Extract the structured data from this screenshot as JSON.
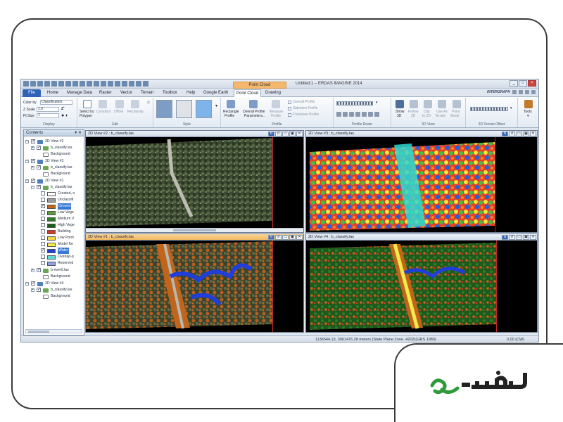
{
  "window": {
    "title": "Untitled:1 – ERDAS IMAGINE 2014",
    "context_tab": "Point Cloud",
    "brand": "INTERGRAPH"
  },
  "tabs": [
    {
      "label": "File"
    },
    {
      "label": "Home"
    },
    {
      "label": "Manage Data"
    },
    {
      "label": "Raster"
    },
    {
      "label": "Vector"
    },
    {
      "label": "Terrain"
    },
    {
      "label": "Toolbox"
    },
    {
      "label": "Help"
    },
    {
      "label": "Google Earth"
    },
    {
      "label": "Point Cloud"
    },
    {
      "label": "Drawing"
    }
  ],
  "ribbon": {
    "display": {
      "color_by_label": "Color by",
      "color_by_value": "Classification",
      "z_scale_label": "Z Scale",
      "z_scale_value": "1.0",
      "pt_size_label": "Pt Size",
      "pt_size_value": "1",
      "group": "Display"
    },
    "edit": {
      "select_by": "Select by",
      "polygon": "Polygon",
      "constant": "Constant",
      "offset": "Offset",
      "reclassify": "Reclassify",
      "group": "Edit"
    },
    "style": {
      "group": "Style"
    },
    "profile": {
      "rectangle": "Rectangle",
      "rectangle_sub": "Profile",
      "overall_params": "Overall Profile",
      "overall_params_sub": "Parameters...",
      "measure": "Measure",
      "measure_sub": "Profile",
      "overall": "Overall Profile",
      "sideview": "Sideview Profile",
      "frontview": "Frontview Profile",
      "group": "Profile"
    },
    "profile_roam": {
      "group": "Profile Roam"
    },
    "view3d": {
      "show": "Show",
      "show_sub": "3D",
      "follow": "Follow",
      "follow_sub": "2D",
      "clip": "Clip",
      "clip_sub": "to 2D",
      "use_as": "Use As",
      "use_as_sub": "Terrain",
      "point": "Point",
      "point_sub": "Mode",
      "group": "3D View"
    },
    "terrain_offset": {
      "group": "3D Terrain Offset"
    },
    "tools": {
      "label": "Tools"
    }
  },
  "contents": {
    "title": "Contents",
    "tree": [
      {
        "label": "2D View #2"
      },
      {
        "label": "b_classify.las"
      },
      {
        "label": "Background"
      },
      {
        "label": "2D View #3"
      },
      {
        "label": "b_classify.las"
      },
      {
        "label": "Background"
      },
      {
        "label": "2D View #1"
      },
      {
        "label": "b_classify.las"
      },
      {
        "label": "Created, n"
      },
      {
        "label": "Unclassifi"
      },
      {
        "label": "Ground"
      },
      {
        "label": "Low Vege"
      },
      {
        "label": "Medium V"
      },
      {
        "label": "High Vege"
      },
      {
        "label": "Building"
      },
      {
        "label": "Low Point"
      },
      {
        "label": "Model Ke"
      },
      {
        "label": "Water"
      },
      {
        "label": "Overlap-p"
      },
      {
        "label": "Reserved"
      },
      {
        "label": "b-river0.las"
      },
      {
        "label": "Background"
      },
      {
        "label": "2D View #4"
      },
      {
        "label": "b_classify.las"
      },
      {
        "label": "Background"
      }
    ]
  },
  "views": {
    "v2": {
      "title": "2D View #2 : b_classify.las"
    },
    "v3": {
      "title": "2D View #3 : b_classify.las"
    },
    "v1": {
      "title": "2D View #1 : b_classify.las"
    },
    "v4": {
      "title": "2D View #4 : b_classify.las"
    }
  },
  "statusbar": {
    "coords": "1136544.13, 3061476.28 meters (State Plane Zone -4202)(GRS 1980)",
    "angle": "0.00 (CW)"
  },
  "colors": {
    "created": "#ffffff",
    "unclassified": "#9a9a9a",
    "ground": "#c0651c",
    "low_veg": "#5f9b3a",
    "medium_veg": "#2f7a2a",
    "high_veg": "#1b5e1b",
    "building": "#d63a2a",
    "low_point": "#f2d64b",
    "model_key": "#f7e94a",
    "water": "#1f3fd8",
    "overlap": "#5fd9d6",
    "reserved": "#8fa0e8"
  },
  "logo": {
    "text": "مسترس"
  }
}
